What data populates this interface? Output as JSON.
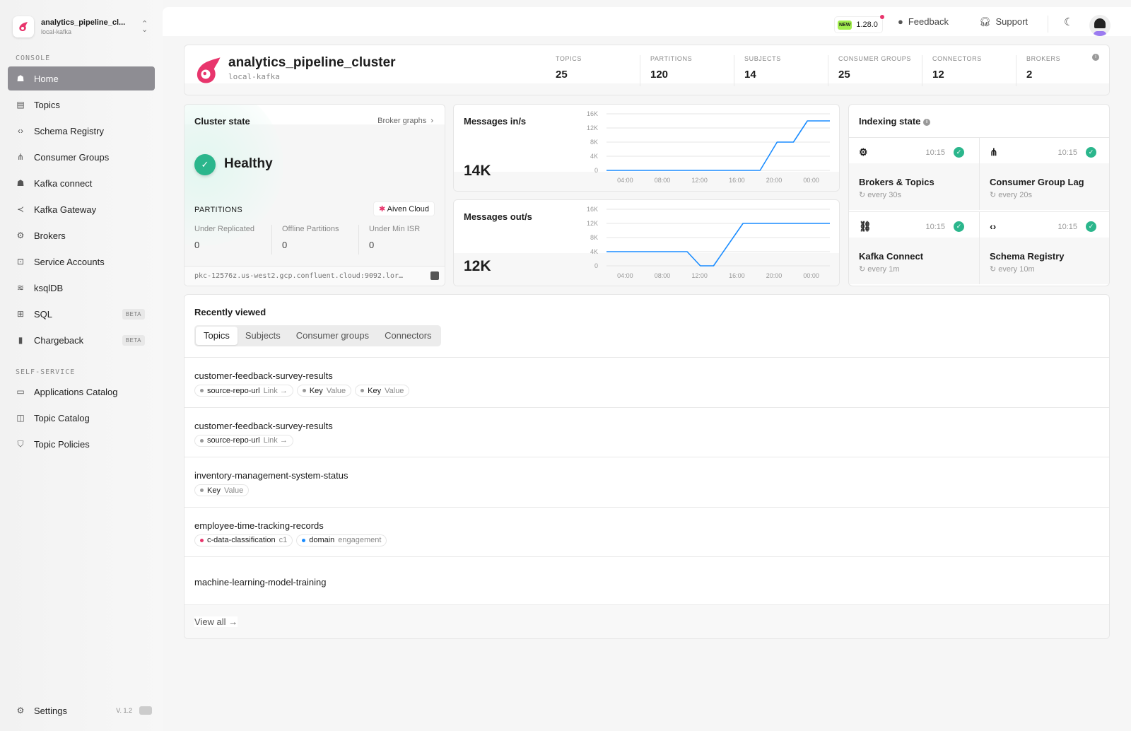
{
  "sidebar": {
    "cluster_name": "analytics_pipeline_cl...",
    "cluster_sub": "local-kafka",
    "console_label": "CONSOLE",
    "self_service_label": "SELF-SERVICE",
    "console_items": [
      {
        "label": "Home",
        "icon": "home-icon",
        "active": true
      },
      {
        "label": "Topics",
        "icon": "topics-icon"
      },
      {
        "label": "Schema Registry",
        "icon": "code-icon"
      },
      {
        "label": "Consumer Groups",
        "icon": "hierarchy-icon"
      },
      {
        "label": "Kafka connect",
        "icon": "connect-icon"
      },
      {
        "label": "Kafka Gateway",
        "icon": "gateway-icon"
      },
      {
        "label": "Brokers",
        "icon": "chip-icon"
      },
      {
        "label": "Service Accounts",
        "icon": "service-account-icon"
      },
      {
        "label": "ksqlDB",
        "icon": "database-icon"
      },
      {
        "label": "SQL",
        "icon": "table-icon",
        "badge": "BETA"
      },
      {
        "label": "Chargeback",
        "icon": "bar-chart-icon",
        "badge": "BETA"
      }
    ],
    "self_service_items": [
      {
        "label": "Applications Catalog",
        "icon": "window-icon"
      },
      {
        "label": "Topic Catalog",
        "icon": "catalog-icon"
      },
      {
        "label": "Topic Policies",
        "icon": "shield-icon"
      }
    ],
    "settings_label": "Settings",
    "version": "V. 1.2"
  },
  "topbar": {
    "new_badge": "NEW",
    "version": "1.28.0",
    "feedback": "Feedback",
    "support": "Support"
  },
  "cluster": {
    "name": "analytics_pipeline_cluster",
    "sub": "local-kafka",
    "stats": [
      {
        "label": "TOPICS",
        "value": "25"
      },
      {
        "label": "PARTITIONS",
        "value": "120"
      },
      {
        "label": "SUBJECTS",
        "value": "14"
      },
      {
        "label": "CONSUMER GROUPS",
        "value": "25"
      },
      {
        "label": "CONNECTORS",
        "value": "12"
      },
      {
        "label": "BROKERS",
        "value": "2"
      }
    ]
  },
  "cluster_state": {
    "title": "Cluster state",
    "broker_graphs": "Broker graphs",
    "status": "Healthy",
    "partitions_label": "PARTITIONS",
    "provider": "Aiven Cloud",
    "metrics": [
      {
        "label": "Under Replicated",
        "value": "0"
      },
      {
        "label": "Offline Partitions",
        "value": "0"
      },
      {
        "label": "Under Min ISR",
        "value": "0"
      }
    ],
    "bootstrap": "pkc-12576z.us-west2.gcp.confluent.cloud:9092.lor…"
  },
  "chart_data": [
    {
      "type": "line",
      "title": "Messages in/s",
      "current": "14K",
      "ylim": [
        0,
        16000
      ],
      "yticks": [
        "0",
        "4K",
        "8K",
        "12K",
        "16K"
      ],
      "xticks": [
        "04:00",
        "08:00",
        "12:00",
        "16:00",
        "20:00",
        "00:00"
      ],
      "color": "#1a8cff",
      "grid": true,
      "points": [
        [
          "02:00",
          0
        ],
        [
          "18:30",
          0
        ],
        [
          "20:20",
          8000
        ],
        [
          "22:05",
          8000
        ],
        [
          "23:35",
          14000
        ],
        [
          "02:00",
          14000
        ]
      ]
    },
    {
      "type": "line",
      "title": "Messages out/s",
      "current": "12K",
      "ylim": [
        0,
        16000
      ],
      "yticks": [
        "0",
        "4K",
        "8K",
        "12K",
        "16K"
      ],
      "xticks": [
        "04:00",
        "08:00",
        "12:00",
        "16:00",
        "20:00",
        "00:00"
      ],
      "color": "#1a8cff",
      "grid": true,
      "points": [
        [
          "02:00",
          4000
        ],
        [
          "10:40",
          4000
        ],
        [
          "12:05",
          0
        ],
        [
          "13:30",
          0
        ],
        [
          "16:40",
          12000
        ],
        [
          "02:00",
          12000
        ]
      ]
    }
  ],
  "indexing": {
    "title": "Indexing state",
    "items": [
      {
        "name": "Brokers & Topics",
        "time": "10:15",
        "freq": "every 30s",
        "icon": "chip-icon"
      },
      {
        "name": "Consumer Group Lag",
        "time": "10:15",
        "freq": "every 20s",
        "icon": "hierarchy-icon"
      },
      {
        "name": "Kafka Connect",
        "time": "10:15",
        "freq": "every 1m",
        "icon": "link-icon"
      },
      {
        "name": "Schema Registry",
        "time": "10:15",
        "freq": "every 10m",
        "icon": "code-icon"
      }
    ]
  },
  "recent": {
    "title": "Recently viewed",
    "tabs": [
      "Topics",
      "Subjects",
      "Consumer groups",
      "Connectors"
    ],
    "active_tab": "Topics",
    "view_all": "View all",
    "rows": [
      {
        "name": "customer-feedback-survey-results",
        "tags": [
          {
            "k": "source-repo-url",
            "v": "Link →",
            "dot": "#999"
          },
          {
            "k": "Key",
            "v": "Value",
            "dot": "#999"
          },
          {
            "k": "Key",
            "v": "Value",
            "dot": "#999"
          }
        ]
      },
      {
        "name": "customer-feedback-survey-results",
        "tags": [
          {
            "k": "source-repo-url",
            "v": "Link →",
            "dot": "#999"
          }
        ]
      },
      {
        "name": "inventory-management-system-status",
        "tags": [
          {
            "k": "Key",
            "v": "Value",
            "dot": "#999"
          }
        ]
      },
      {
        "name": "employee-time-tracking-records",
        "tags": [
          {
            "k": "c-data-classification",
            "v": "c1",
            "dot": "#e8356c"
          },
          {
            "k": "domain",
            "v": "engagement",
            "dot": "#1a8cff"
          }
        ]
      },
      {
        "name": "machine-learning-model-training",
        "tags": []
      }
    ]
  },
  "colors": {
    "accent": "#e8356c",
    "healthy": "#2bb68c",
    "line": "#1a8cff"
  }
}
